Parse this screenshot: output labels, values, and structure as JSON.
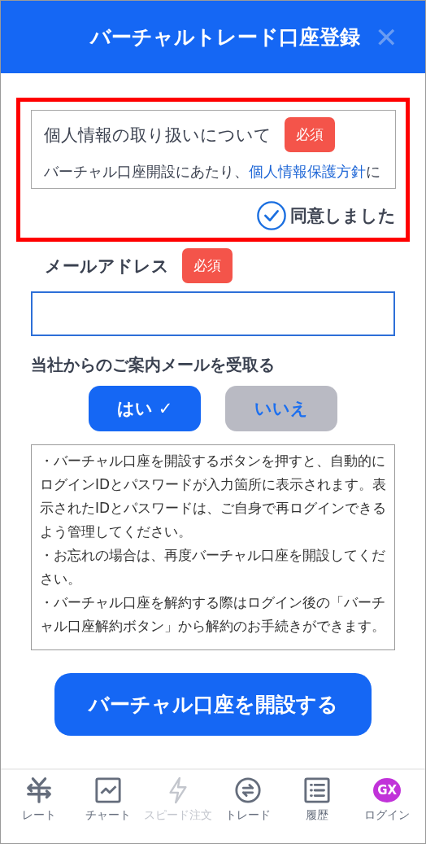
{
  "header": {
    "title": "バーチャルトレード口座登録",
    "close": "✕"
  },
  "privacy": {
    "title": "個人情報の取り扱いについて",
    "required": "必須",
    "text": "バーチャル口座開設にあたり、",
    "link": "個人情報保護方針",
    "text_after": "に",
    "agree": {
      "label": "同意しました",
      "checked": true
    }
  },
  "email": {
    "label": "メールアドレス",
    "required": "必須"
  },
  "newsletter": {
    "label": "当社からのご案内メールを受取る",
    "options": [
      {
        "label": "はい ✓",
        "selected": true
      },
      {
        "label": "いいえ",
        "selected": false
      }
    ]
  },
  "notice": [
    "・バーチャル口座を開設するボタンを押すと、自動的にログインIDとパスワードが入力箇所に表示されます。表示されたIDとパスワードは、ご自身で再ログインできるよう管理してください。",
    "・お忘れの場合は、再度バーチャル口座を開設してください。",
    "・バーチャル口座を解約する際はログイン後の「バーチャル口座解約ボタン」から解約のお手続きができます。"
  ],
  "submit": "バーチャル口座を開設する",
  "nav": [
    {
      "kind": "yen",
      "label": "レート",
      "disabled": false
    },
    {
      "kind": "chart",
      "label": "チャート",
      "disabled": false
    },
    {
      "kind": "bolt",
      "label": "スピード注文",
      "disabled": true
    },
    {
      "kind": "swap",
      "label": "トレード",
      "disabled": false
    },
    {
      "kind": "list",
      "label": "履歴",
      "disabled": false
    },
    {
      "kind": "login",
      "label": "ログイン",
      "badge": "GX",
      "disabled": false
    }
  ]
}
